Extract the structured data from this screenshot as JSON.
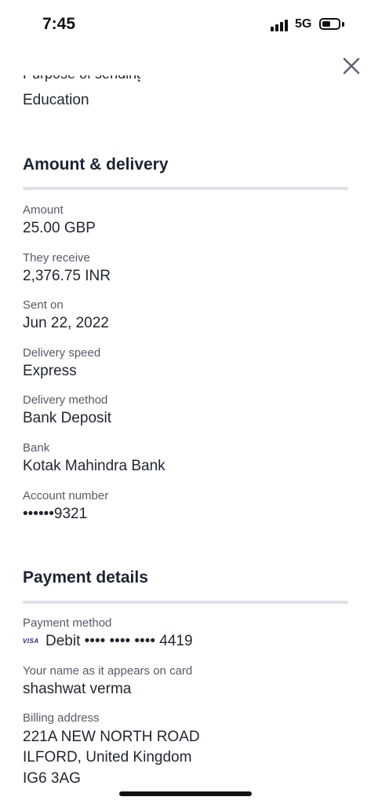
{
  "status_bar": {
    "time": "7:45",
    "network": "5G"
  },
  "top_partial": {
    "cut_text": "Purpose of sending",
    "value": "Education"
  },
  "amount_delivery": {
    "title": "Amount & delivery",
    "fields": [
      {
        "label": "Amount",
        "value": "25.00 GBP"
      },
      {
        "label": "They receive",
        "value": "2,376.75 INR"
      },
      {
        "label": "Sent on",
        "value": "Jun 22, 2022"
      },
      {
        "label": "Delivery speed",
        "value": "Express"
      },
      {
        "label": "Delivery method",
        "value": "Bank Deposit"
      },
      {
        "label": "Bank",
        "value": "Kotak Mahindra Bank"
      },
      {
        "label": "Account number",
        "value": "••••••9321"
      }
    ]
  },
  "payment_details": {
    "title": "Payment details",
    "payment_method_label": "Payment method",
    "card_brand_text": "VISA",
    "payment_method_value": "Debit •••• •••• •••• 4419",
    "name_label": "Your name as it appears on card",
    "name_value": "shashwat verma",
    "billing_label": "Billing address",
    "billing_lines": [
      "221A NEW NORTH ROAD",
      "ILFORD, United Kingdom",
      "IG6 3AG"
    ]
  },
  "icons": {
    "close": "close-icon",
    "signal": "signal-icon",
    "battery": "battery-icon",
    "card": "visa-icon"
  },
  "colors": {
    "text_primary": "#1f2530",
    "text_secondary": "#545b68",
    "divider": "#dde2ea",
    "close_icon": "#5b6577"
  }
}
